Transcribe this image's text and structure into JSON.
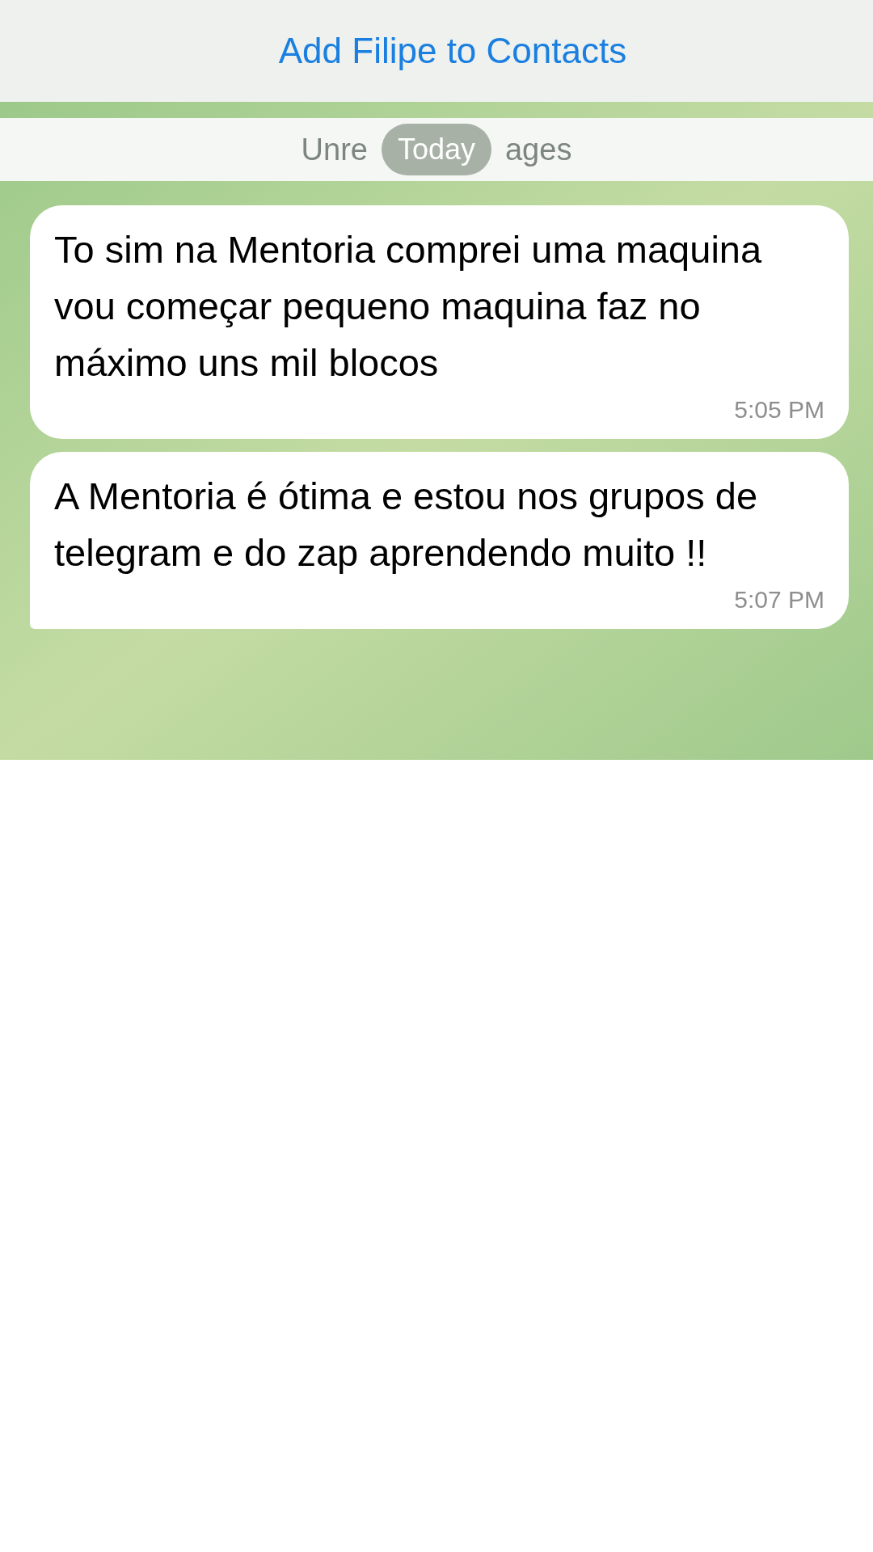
{
  "top_bar": {
    "action": "Add Filipe to Contacts"
  },
  "unread_banner": {
    "left_text": "Unre",
    "right_text": "ages"
  },
  "date_pill": "Today",
  "messages": [
    {
      "text": "To sim na Mentoria  comprei uma maquina vou começar pequeno maquina faz no máximo uns mil blocos",
      "time": "5:05 PM",
      "tail": false
    },
    {
      "text": "A Mentoria é ótima e estou nos grupos de telegram e do zap aprendendo muito !!",
      "time": "5:07 PM",
      "tail": true
    }
  ]
}
